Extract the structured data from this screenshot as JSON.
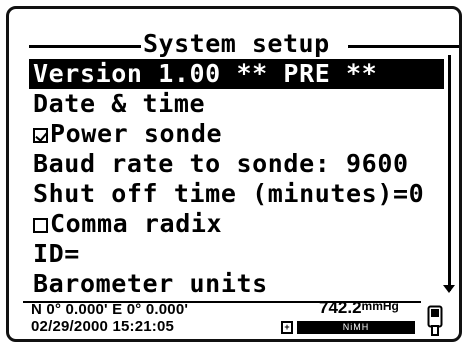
{
  "screen": {
    "title": "System setup",
    "menu_items": [
      {
        "label": "Version 1.00 ** PRE **",
        "selected": true,
        "checkbox": null
      },
      {
        "label": "Date & time",
        "selected": false,
        "checkbox": null
      },
      {
        "label": "Power sonde",
        "selected": false,
        "checkbox": "checked"
      },
      {
        "label": "Baud rate to sonde: 9600",
        "selected": false,
        "checkbox": null
      },
      {
        "label": "Shut off time (minutes)=0",
        "selected": false,
        "checkbox": null
      },
      {
        "label": "Comma radix",
        "selected": false,
        "checkbox": "unchecked"
      },
      {
        "label": "ID=",
        "selected": false,
        "checkbox": null
      },
      {
        "label": "Barometer units",
        "selected": false,
        "checkbox": null
      }
    ]
  },
  "status": {
    "coordinates": "N 0° 0.000' E  0° 0.000'",
    "datetime": "02/29/2000 15:21:05",
    "pressure_value": "742.2",
    "pressure_unit": "mmHg",
    "battery_label": "NiMH",
    "battery_symbol": "+"
  },
  "icons": {
    "scroll": "scroll-down-arrow-icon",
    "device": "handheld-device-icon",
    "battery": "battery-icon"
  }
}
